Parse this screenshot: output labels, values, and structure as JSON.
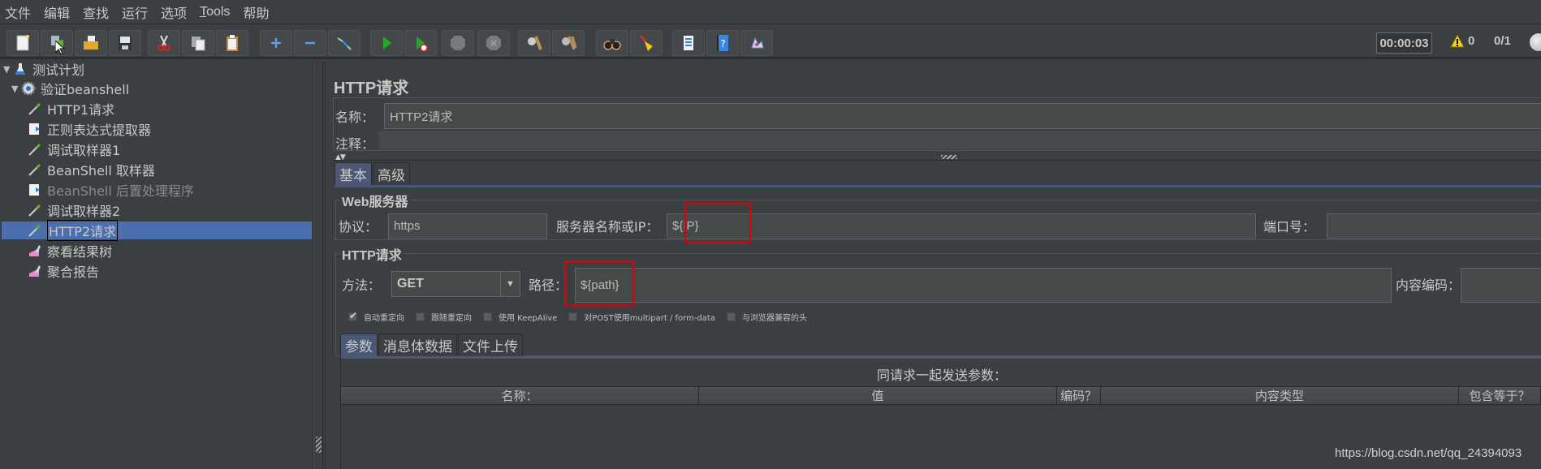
{
  "menu": [
    "文件",
    "编辑",
    "查找",
    "运行",
    "选项",
    "Tools",
    "帮助"
  ],
  "toolbar": {
    "buttons": [
      {
        "name": "new-icon"
      },
      {
        "name": "templates-icon"
      },
      {
        "name": "open-icon"
      },
      {
        "name": "save-icon"
      },
      {
        "name": "cut-icon"
      },
      {
        "name": "copy-icon"
      },
      {
        "name": "paste-icon"
      },
      {
        "name": "expand-icon"
      },
      {
        "name": "collapse-icon"
      },
      {
        "name": "toggle-icon"
      },
      {
        "name": "start-icon"
      },
      {
        "name": "start-no-pause-icon"
      },
      {
        "name": "stop-icon"
      },
      {
        "name": "shutdown-icon"
      },
      {
        "name": "clear-icon"
      },
      {
        "name": "clear-all-icon"
      },
      {
        "name": "search-icon"
      },
      {
        "name": "reset-search-icon"
      },
      {
        "name": "function-helper-icon"
      },
      {
        "name": "help-icon"
      },
      {
        "name": "remote-icon"
      }
    ],
    "timer": "00:00:03",
    "warning_count": "0",
    "threads": "0/1"
  },
  "tree": {
    "items": [
      {
        "label": "测试计划",
        "icon": "test-plan-icon",
        "toggle": "▼",
        "level": 0
      },
      {
        "label": "验证beanshell",
        "icon": "thread-group-icon",
        "toggle": "▼",
        "level": 1
      },
      {
        "label": "HTTP1请求",
        "icon": "sampler-icon",
        "level": 2
      },
      {
        "label": "正则表达式提取器",
        "icon": "post-processor-icon",
        "level": 2
      },
      {
        "label": "调试取样器1",
        "icon": "sampler-icon",
        "level": 2
      },
      {
        "label": "BeanShell 取样器",
        "icon": "sampler-icon",
        "level": 2
      },
      {
        "label": "BeanShell 后置处理程序",
        "icon": "post-processor-icon",
        "level": 2,
        "disabled": true
      },
      {
        "label": "调试取样器2",
        "icon": "sampler-icon",
        "level": 2
      },
      {
        "label": "HTTP2请求",
        "icon": "sampler-icon",
        "level": 2,
        "selected": true
      },
      {
        "label": "察看结果树",
        "icon": "listener-icon",
        "level": 2
      },
      {
        "label": "聚合报告",
        "icon": "listener-icon",
        "level": 2
      }
    ]
  },
  "panel": {
    "title": "HTTP请求",
    "name_label": "名称：",
    "name_value": "HTTP2请求",
    "comment_label": "注释：",
    "comment_value": "",
    "tabs": [
      "基本",
      "高级"
    ],
    "active_tab": 0,
    "web_server": {
      "title": "Web服务器",
      "protocol_label": "协议：",
      "protocol_value": "https",
      "server_label": "服务器名称或IP：",
      "server_value": "${IP}",
      "port_label": "端口号：",
      "port_value": ""
    },
    "http_request": {
      "title": "HTTP请求",
      "method_label": "方法：",
      "method_value": "GET",
      "path_label": "路径：",
      "path_value": "${path}",
      "encoding_label": "内容编码：",
      "encoding_value": ""
    },
    "options": [
      {
        "label": "自动重定向",
        "checked": true
      },
      {
        "label": "跟随重定向",
        "checked": false
      },
      {
        "label": "使用 KeepAlive",
        "checked": false
      },
      {
        "label": "对POST使用multipart / form-data",
        "checked": false
      },
      {
        "label": "与浏览器兼容的头",
        "checked": false
      }
    ],
    "param_tabs": [
      "参数",
      "消息体数据",
      "文件上传"
    ],
    "active_param_tab": 0,
    "param_caption": "同请求一起发送参数：",
    "columns": [
      "名称：",
      "值",
      "编码？",
      "内容类型",
      "包含等于？"
    ]
  },
  "watermark": "https://blog.csdn.net/qq_24394093",
  "colors": {
    "background": "#3c3f41",
    "selection": "#4b6eaf",
    "active_tab": "#4a5875",
    "highlight": "#e00000"
  }
}
